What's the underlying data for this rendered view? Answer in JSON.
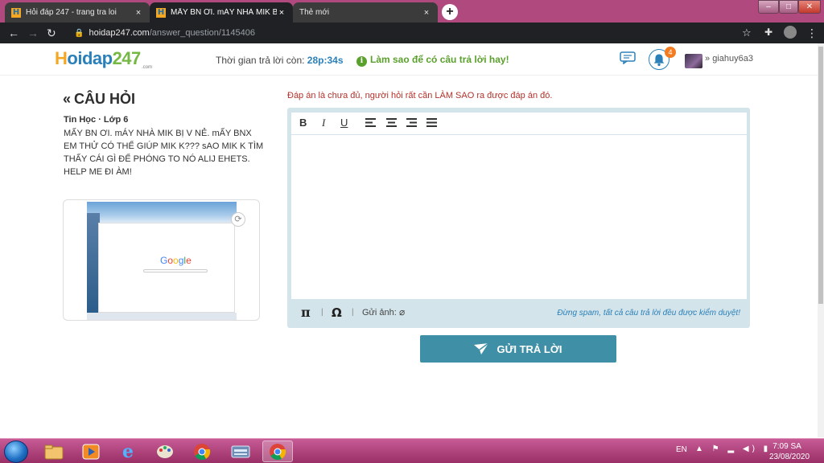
{
  "browser": {
    "tabs": [
      {
        "title": "Hỏi đáp 247 - trang tra loi",
        "close": "×"
      },
      {
        "title": "MẤY BN ƠI. mÁY NHÀ MIK BỊ V NẺ.",
        "close": "×"
      },
      {
        "title": "Thẻ mới",
        "close": "×"
      }
    ],
    "new_tab": "+",
    "window_controls": {
      "minimize": "–",
      "maximize": "□",
      "close": "✕"
    },
    "url_domain": "hoidap247.com",
    "url_path": "/answer_question/1145406"
  },
  "header": {
    "logo": {
      "h": "H",
      "part1": "oidap",
      "part2": "247"
    },
    "logo_sub": ".com",
    "timer_label": "Thời gian trả lời còn:",
    "timer_value": "28p:34s",
    "hint_icon": "i",
    "hint_text": "Làm sao để có câu trả lời hay!",
    "notification_count": "4",
    "username": "giahuy6a3",
    "username_prefix": "»"
  },
  "question": {
    "heading_arrows": "«",
    "heading": "CÂU HỎI",
    "subject": "Tin Học · Lớp 6",
    "text": "MẤY BN ƠI. mÁY NHÀ MIK BỊ V NẺ. mẤY BNX EM THỬ CÓ THỂ GIÚP MIK K??? sAO MIK K TÌM THẤY CÁI GÌ ĐỂ PHÓNG TO NÓ ALIJ EHETS. HELP ME ĐI ÀM!",
    "image_text": "Google",
    "refresh_icon": "⟳"
  },
  "answer": {
    "note": "Đáp án là chưa đủ, người hỏi rất cần LÀM SAO ra được đáp án đó.",
    "toolbar": {
      "bold": "B",
      "italic": "I",
      "underline": "U"
    },
    "pi": "π",
    "omega": "Ω",
    "separator": "|",
    "attach_label": "Gửi ảnh:",
    "spam_note": "Đừng spam, tất cả câu trả lời đều được kiểm duyệt!",
    "submit_label": "GỬI TRẢ LỜI"
  },
  "taskbar": {
    "language": "EN",
    "time": "7:09 SA",
    "date": "23/08/2020"
  }
}
